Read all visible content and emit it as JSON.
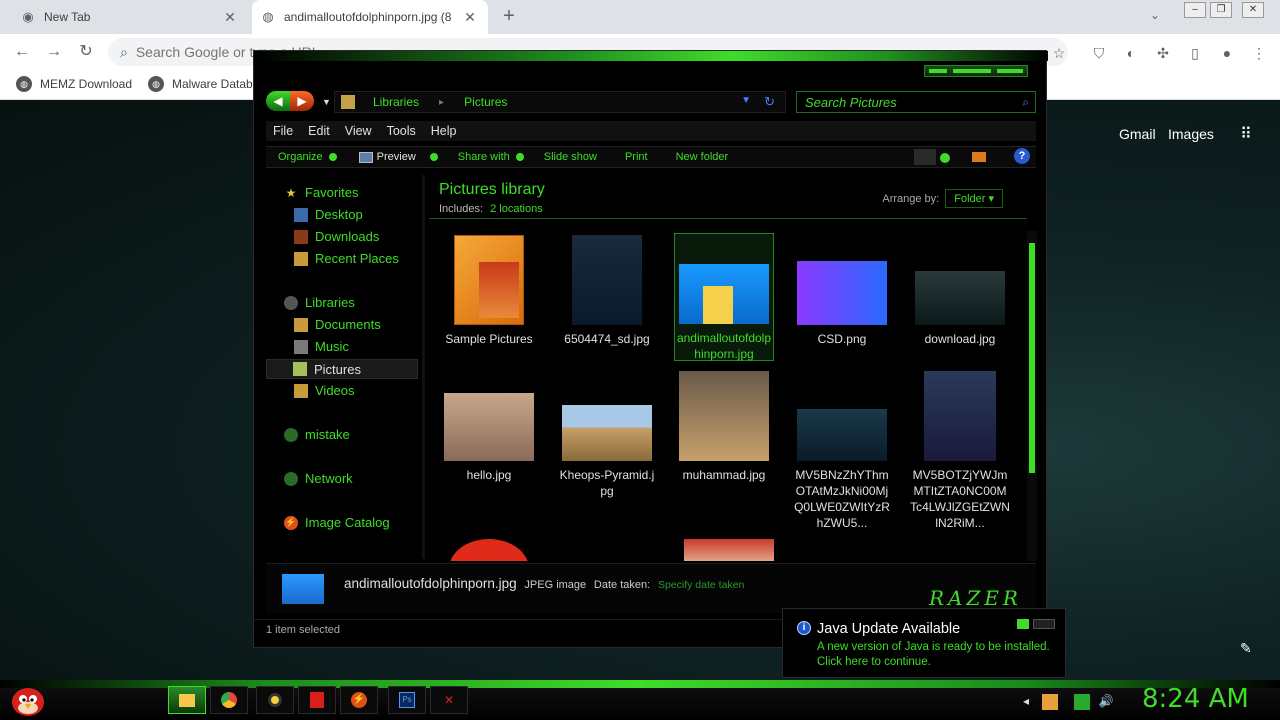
{
  "browser": {
    "tabs": [
      {
        "title": "New Tab"
      },
      {
        "title": "andimalloutofdolphinporn.jpg (8"
      }
    ],
    "omnibox_placeholder": "Search Google or type a URL",
    "bookmarks": [
      "MEMZ Download",
      "Malware Databa"
    ],
    "google_links": [
      "Gmail",
      "Images"
    ]
  },
  "explorer": {
    "breadcrumb": [
      "Libraries",
      "Pictures"
    ],
    "search_placeholder": "Search Pictures",
    "menu": [
      "File",
      "Edit",
      "View",
      "Tools",
      "Help"
    ],
    "commands": {
      "organize": "Organize",
      "preview": "Preview",
      "share": "Share with",
      "slideshow": "Slide show",
      "print": "Print",
      "new_folder": "New folder"
    },
    "nav": {
      "favorites": "Favorites",
      "desktop": "Desktop",
      "downloads": "Downloads",
      "recent": "Recent Places",
      "libraries": "Libraries",
      "documents": "Documents",
      "music": "Music",
      "pictures": "Pictures",
      "videos": "Videos",
      "mistake": "mistake",
      "network": "Network",
      "image_catalog": "Image Catalog"
    },
    "library": {
      "title": "Pictures library",
      "includes_label": "Includes:",
      "locations": "2 locations",
      "arrange_label": "Arrange by:",
      "arrange_value": "Folder"
    },
    "files": [
      {
        "name": "Sample Pictures"
      },
      {
        "name": "6504474_sd.jpg"
      },
      {
        "name": "andimalloutofdolphinporn.jpg"
      },
      {
        "name": "CSD.png"
      },
      {
        "name": "download.jpg"
      },
      {
        "name": "hello.jpg"
      },
      {
        "name": "Kheops-Pyramid.jpg"
      },
      {
        "name": "muhammad.jpg"
      },
      {
        "name": "MV5BNzZhYThmOTAtMzJkNi00MjQ0LWE0ZWItYzRhZWU5..."
      },
      {
        "name": "MV5BOTZjYWJmMTItZTA0NC00MTc4LWJlZGEtZWNlN2RiM..."
      }
    ],
    "details": {
      "name": "andimalloutofdolphinporn.jpg",
      "type": "JPEG image",
      "date_label": "Date taken:",
      "date_value": "Specify date taken",
      "logo": "RAZER"
    },
    "status": "1 item selected"
  },
  "notification": {
    "title": "Java Update Available",
    "line1": "A new version of Java is ready to be installed.",
    "line2": "Click here to continue."
  },
  "taskbar": {
    "clock": "8:24 AM"
  },
  "colors": {
    "accent": "#3fdc2a",
    "background": "#000000"
  }
}
